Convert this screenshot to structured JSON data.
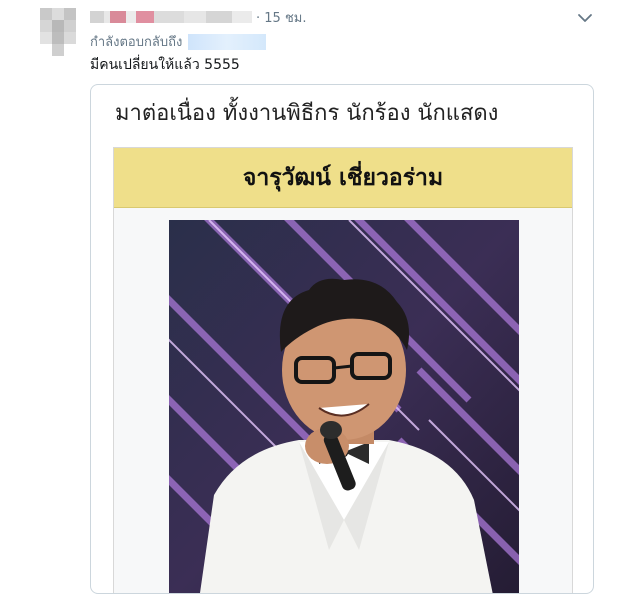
{
  "tweet": {
    "time": "· 15 ชม.",
    "reply_to_prefix": "กำลังตอบกลับถึง",
    "text": "มีคนเปลี่ยนให้แล้ว 5555"
  },
  "card": {
    "heading": "มาต่อเนื่อง ทั้งงานพิธีกร นักร้อง นักแสดง",
    "banner_title": "จารุวัฒน์ เชี่ยวอร่าม"
  },
  "icons": {
    "menu": "chevron-down-icon"
  },
  "colors": {
    "banner": "#efdf8a",
    "secondary_text": "#657786",
    "blurred_mention": "#d4e8fb",
    "blurred_name": "#d98a99"
  }
}
